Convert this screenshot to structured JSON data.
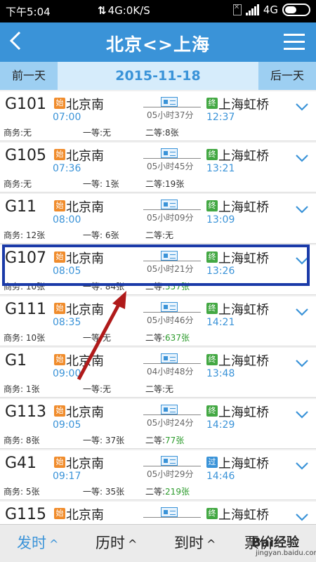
{
  "status_bar": {
    "time": "下午5:04",
    "network_arrows": "⇅",
    "network": "4G:0K/S",
    "carrier": "4G"
  },
  "header": {
    "back_icon": "chevron-left-icon",
    "title": "北京<>上海",
    "menu_icon": "menu-icon"
  },
  "date_bar": {
    "prev_label": "前一天",
    "date": "2015-11-18",
    "next_label": "后一天"
  },
  "badges": {
    "start": "始",
    "end": "终",
    "pass": "过"
  },
  "trains": [
    {
      "code": "G101",
      "dep_badge": "始",
      "dep_station": "北京南",
      "dep_time": "07:00",
      "duration": "05小时37分",
      "arr_badge": "终",
      "arr_station": "上海虹桥",
      "arr_time": "12:37",
      "biz": "商务:无",
      "first": "一等:无",
      "second_label": "二等:",
      "second_value": "8张",
      "second_green": false
    },
    {
      "code": "G105",
      "dep_badge": "始",
      "dep_station": "北京南",
      "dep_time": "07:36",
      "duration": "05小时45分",
      "arr_badge": "终",
      "arr_station": "上海虹桥",
      "arr_time": "13:21",
      "biz": "商务:无",
      "first": "一等: 1张",
      "second_label": "二等:",
      "second_value": "19张",
      "second_green": false
    },
    {
      "code": "G11",
      "dep_badge": "始",
      "dep_station": "北京南",
      "dep_time": "08:00",
      "duration": "05小时09分",
      "arr_badge": "终",
      "arr_station": "上海虹桥",
      "arr_time": "13:09",
      "biz": "商务: 12张",
      "first": "一等: 6张",
      "second_label": "二等:",
      "second_value": "无",
      "second_green": false
    },
    {
      "code": "G107",
      "dep_badge": "始",
      "dep_station": "北京南",
      "dep_time": "08:05",
      "duration": "05小时21分",
      "arr_badge": "终",
      "arr_station": "上海虹桥",
      "arr_time": "13:26",
      "biz": "商务: 10张",
      "first": "一等: 84张",
      "second_label": "二等:",
      "second_value": "557张",
      "second_green": true
    },
    {
      "code": "G111",
      "dep_badge": "始",
      "dep_station": "北京南",
      "dep_time": "08:35",
      "duration": "05小时46分",
      "arr_badge": "终",
      "arr_station": "上海虹桥",
      "arr_time": "14:21",
      "biz": "商务: 10张",
      "first": "一等:无",
      "second_label": "二等:",
      "second_value": "637张",
      "second_green": true
    },
    {
      "code": "G1",
      "dep_badge": "始",
      "dep_station": "北京南",
      "dep_time": "09:00",
      "duration": "04小时48分",
      "arr_badge": "终",
      "arr_station": "上海虹桥",
      "arr_time": "13:48",
      "biz": "商务: 1张",
      "first": "一等:无",
      "second_label": "二等:",
      "second_value": "无",
      "second_green": false
    },
    {
      "code": "G113",
      "dep_badge": "始",
      "dep_station": "北京南",
      "dep_time": "09:05",
      "duration": "05小时24分",
      "arr_badge": "终",
      "arr_station": "上海虹桥",
      "arr_time": "14:29",
      "biz": "商务: 8张",
      "first": "一等: 37张",
      "second_label": "二等:",
      "second_value": "77张",
      "second_green": true
    },
    {
      "code": "G41",
      "dep_badge": "始",
      "dep_station": "北京南",
      "dep_time": "09:17",
      "duration": "05小时29分",
      "arr_badge": "过",
      "arr_station": "上海虹桥",
      "arr_time": "14:46",
      "biz": "商务: 5张",
      "first": "一等: 35张",
      "second_label": "二等:",
      "second_value": "219张",
      "second_green": true
    },
    {
      "code": "G115",
      "dep_badge": "始",
      "dep_station": "北京南",
      "dep_time": "",
      "duration": "",
      "arr_badge": "终",
      "arr_station": "上海虹桥",
      "arr_time": "",
      "biz": "",
      "first": "",
      "second_label": "",
      "second_value": "",
      "second_green": false
    }
  ],
  "bottom_tabs": [
    {
      "label": "发时",
      "caret": "^",
      "active": true
    },
    {
      "label": "历时",
      "caret": "^",
      "active": false
    },
    {
      "label": "到时",
      "caret": "^",
      "active": false
    },
    {
      "label": "票价",
      "caret": "",
      "active": false
    }
  ],
  "watermark": {
    "text": "Bai经验",
    "sub": "jingyan.baidu.com"
  },
  "colors": {
    "brand_blue": "#3a93d8",
    "start_orange": "#f08c2c",
    "end_green": "#43a843",
    "seat_green": "#2e9c2e",
    "highlight_navy": "#1a3aa8",
    "arrow_red": "#b01a1a"
  }
}
